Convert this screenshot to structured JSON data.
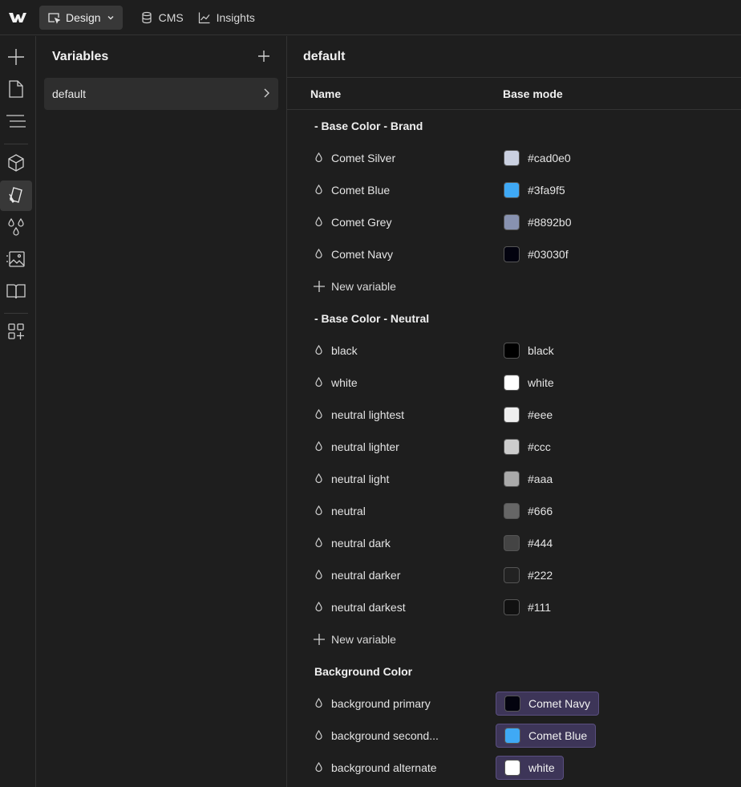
{
  "topbar": {
    "tabs": [
      {
        "label": "Design",
        "icon": "cursor-select-icon"
      },
      {
        "label": "CMS",
        "icon": "database-icon"
      },
      {
        "label": "Insights",
        "icon": "line-chart-icon"
      }
    ]
  },
  "variables_panel": {
    "title": "Variables",
    "collection": "default"
  },
  "main": {
    "title": "default",
    "columns": {
      "name": "Name",
      "mode": "Base mode"
    },
    "new_variable_label": "New variable",
    "groups": [
      {
        "title": "- Base Color - Brand",
        "vars": [
          {
            "name": "Comet Silver",
            "value": "#cad0e0",
            "swatch": "#cad0e0"
          },
          {
            "name": "Comet Blue",
            "value": "#3fa9f5",
            "swatch": "#3fa9f5"
          },
          {
            "name": "Comet Grey",
            "value": "#8892b0",
            "swatch": "#8892b0"
          },
          {
            "name": "Comet Navy",
            "value": "#03030f",
            "swatch": "#03030f"
          }
        ]
      },
      {
        "title": "- Base Color - Neutral",
        "vars": [
          {
            "name": "black",
            "value": "black",
            "swatch": "#000000"
          },
          {
            "name": "white",
            "value": "white",
            "swatch": "#ffffff"
          },
          {
            "name": "neutral lightest",
            "value": "#eee",
            "swatch": "#eeeeee"
          },
          {
            "name": "neutral lighter",
            "value": "#ccc",
            "swatch": "#cccccc"
          },
          {
            "name": "neutral light",
            "value": "#aaa",
            "swatch": "#aaaaaa"
          },
          {
            "name": "neutral",
            "value": "#666",
            "swatch": "#666666"
          },
          {
            "name": "neutral dark",
            "value": "#444",
            "swatch": "#444444"
          },
          {
            "name": "neutral darker",
            "value": "#222",
            "swatch": "#222222"
          },
          {
            "name": "neutral darkest",
            "value": "#111",
            "swatch": "#111111"
          }
        ]
      },
      {
        "title": "Background Color",
        "vars": [
          {
            "name": "background primary",
            "value": "Comet Navy",
            "swatch": "#03030f",
            "reference": true
          },
          {
            "name": "background second...",
            "value": "Comet Blue",
            "swatch": "#3fa9f5",
            "reference": true
          },
          {
            "name": "background alternate",
            "value": "white",
            "swatch": "#ffffff",
            "reference": true
          }
        ]
      }
    ]
  }
}
